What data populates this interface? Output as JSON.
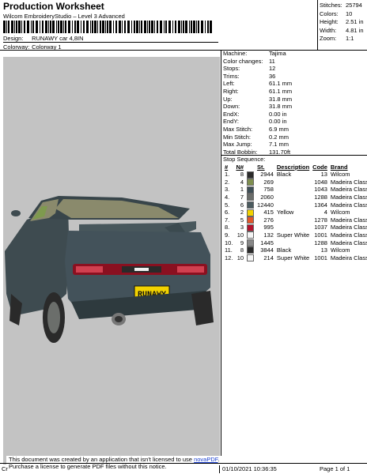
{
  "header": {
    "title": "Production Worksheet",
    "subtitle": "Wilcom EmbroideryStudio – Level 3 Advanced",
    "barcode_text": "barcode",
    "design_label": "Design:",
    "design_value": "RUNAWY car 4,8IN",
    "colorway_label": "Colorway:",
    "colorway_value": "Colorway 1"
  },
  "stats": [
    {
      "k": "Stitches:",
      "v": "25794"
    },
    {
      "k": "Colors:",
      "v": "10"
    },
    {
      "k": "Height:",
      "v": "2.51 in"
    },
    {
      "k": "Width:",
      "v": "4.81 in"
    },
    {
      "k": "Zoom:",
      "v": "1:1"
    }
  ],
  "machine_info": [
    {
      "k": "Machine:",
      "v": "Tajima"
    },
    {
      "k": "Color changes:",
      "v": "11"
    },
    {
      "k": "Stops:",
      "v": "12"
    },
    {
      "k": "Trims:",
      "v": "36"
    },
    {
      "k": "Left:",
      "v": "61.1 mm"
    },
    {
      "k": "Right:",
      "v": "61.1 mm"
    },
    {
      "k": "Up:",
      "v": "31.8 mm"
    },
    {
      "k": "Down:",
      "v": "31.8 mm"
    },
    {
      "k": "EndX:",
      "v": "0.00 in"
    },
    {
      "k": "EndY:",
      "v": "0.00 in"
    },
    {
      "k": "Max Stitch:",
      "v": "6.9 mm"
    },
    {
      "k": "Min Stitch:",
      "v": "0.2 mm"
    },
    {
      "k": "Max Jump:",
      "v": "7.1 mm"
    },
    {
      "k": "Total Bobbin:",
      "v": "131.70ft"
    }
  ],
  "stop_sequence_label": "Stop Sequence:",
  "stop_headers": [
    "#",
    "N#",
    "",
    "St.",
    "Description",
    "Code",
    "Brand"
  ],
  "stops": [
    {
      "n": "1.",
      "needle": "8",
      "color": "#2b2b2b",
      "st": "2944",
      "desc": "Black",
      "code": "13",
      "brand": "Wilcom"
    },
    {
      "n": "2.",
      "needle": "4",
      "color": "#7f8f4f",
      "st": "269",
      "desc": "",
      "code": "1048",
      "brand": "Madeira Classic 40"
    },
    {
      "n": "3.",
      "needle": "1",
      "color": "#3f4f56",
      "st": "758",
      "desc": "",
      "code": "1043",
      "brand": "Madeira Classic 40"
    },
    {
      "n": "4.",
      "needle": "7",
      "color": "#6b6e6b",
      "st": "2060",
      "desc": "",
      "code": "1288",
      "brand": "Madeira Classic 40"
    },
    {
      "n": "5.",
      "needle": "6",
      "color": "#4a5a5e",
      "st": "12440",
      "desc": "",
      "code": "1364",
      "brand": "Madeira Classic 40"
    },
    {
      "n": "6.",
      "needle": "2",
      "color": "#f2d200",
      "st": "415",
      "desc": "Yellow",
      "code": "4",
      "brand": "Wilcom"
    },
    {
      "n": "7.",
      "needle": "5",
      "color": "#e1562a",
      "st": "276",
      "desc": "",
      "code": "1278",
      "brand": "Madeira Classic 40"
    },
    {
      "n": "8.",
      "needle": "3",
      "color": "#b3122c",
      "st": "995",
      "desc": "",
      "code": "1037",
      "brand": "Madeira Classic 40"
    },
    {
      "n": "9.",
      "needle": "10",
      "color": "#f4f4f4",
      "st": "132",
      "desc": "Super White",
      "code": "1001",
      "brand": "Madeira Classic 40"
    },
    {
      "n": "10.",
      "needle": "9",
      "color": "#888888",
      "st": "1445",
      "desc": "",
      "code": "1288",
      "brand": "Madeira Classic 40"
    },
    {
      "n": "11.",
      "needle": "8",
      "color": "#2b2b2b",
      "st": "3844",
      "desc": "Black",
      "code": "13",
      "brand": "Wilcom"
    },
    {
      "n": "12.",
      "needle": "10",
      "color": "#f4f4f4",
      "st": "214",
      "desc": "Super White",
      "code": "1001",
      "brand": "Madeira Classic 40"
    }
  ],
  "plate_text": "RUNAWY",
  "notice": {
    "line1": "This document was created by an application that isn't licensed to use ",
    "link": "novaPDF",
    "line1_end": ".",
    "line2": "Purchase a license to generate PDF files without this notice."
  },
  "footer": {
    "left": "Cr",
    "date": "01/10/2021 10:36:35",
    "page": "Page 1 of 1"
  },
  "colors": {
    "design_bg": "#c3c3c3",
    "car_body": "#3e4b50",
    "link": "#1a3fd0"
  }
}
